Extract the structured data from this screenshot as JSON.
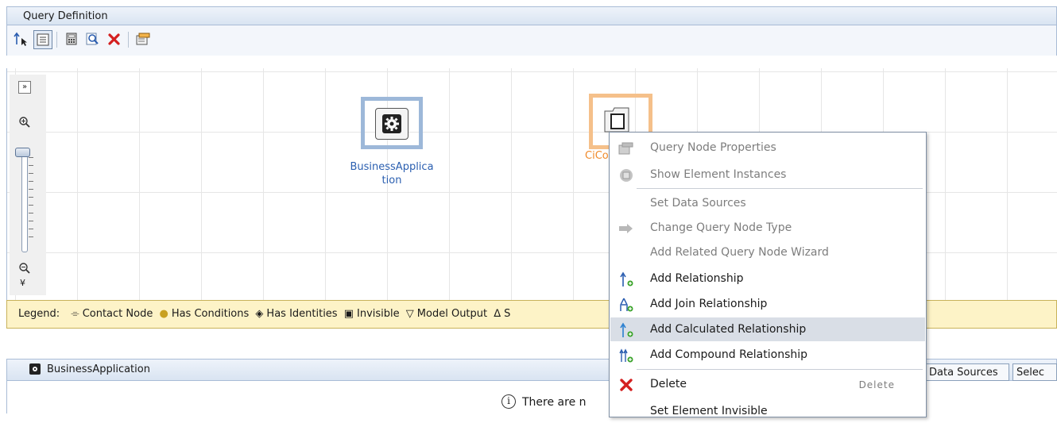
{
  "panel": {
    "title": "Query Definition"
  },
  "toolbar": {
    "icons": [
      "pointer-relationship-icon",
      "list-view-icon",
      "calculator-icon",
      "find-icon",
      "delete-icon",
      "properties-icon"
    ]
  },
  "nodes": {
    "business_application": {
      "label_line1": "BusinessApplica",
      "label_line2": "tion",
      "color": "#9db8d9"
    },
    "ci_collection": {
      "label_partial": "CiCo",
      "color": "#f5c08a"
    }
  },
  "legend": {
    "label": "Legend:",
    "items": [
      "Contact Node",
      "Has Conditions",
      "Has Identities",
      "Invisible",
      "Model Output",
      "S"
    ]
  },
  "context_menu": {
    "items": [
      {
        "label": "Query Node Properties",
        "enabled": false,
        "icon": "properties-icon"
      },
      {
        "label": "Show Element Instances",
        "enabled": false,
        "icon": "instances-icon"
      },
      {
        "label": "Set Data Sources",
        "enabled": false,
        "icon": ""
      },
      {
        "label": "Change Query Node Type",
        "enabled": false,
        "icon": "change-type-icon"
      },
      {
        "label": "Add Related Query Node Wizard",
        "enabled": false,
        "icon": ""
      },
      {
        "label": "Add Relationship",
        "enabled": true,
        "icon": "add-relationship-icon"
      },
      {
        "label": "Add Join Relationship",
        "enabled": true,
        "icon": "add-join-relationship-icon"
      },
      {
        "label": "Add Calculated Relationship",
        "enabled": true,
        "icon": "add-calculated-relationship-icon",
        "highlighted": true
      },
      {
        "label": "Add Compound Relationship",
        "enabled": true,
        "icon": "add-compound-relationship-icon"
      },
      {
        "label": "Delete",
        "enabled": true,
        "icon": "delete-icon",
        "shortcut": "Delete"
      },
      {
        "label": "Set Element Invisible",
        "enabled": true,
        "icon": ""
      }
    ]
  },
  "bottom_panel": {
    "title": "BusinessApplication",
    "message": "There are n",
    "tabs": [
      "Data Sources",
      "Selec"
    ]
  }
}
